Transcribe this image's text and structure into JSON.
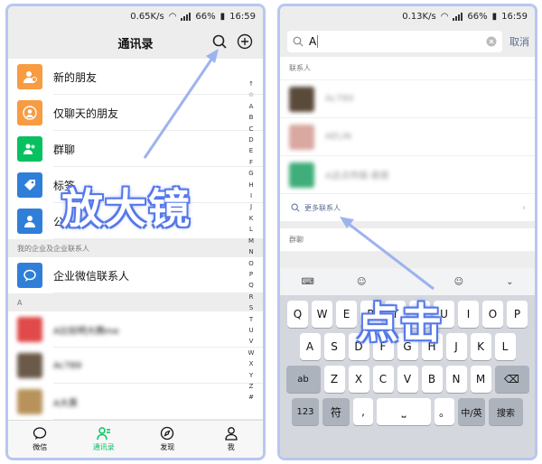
{
  "left": {
    "status": {
      "speed": "0.65K/s",
      "battery": "66%",
      "time": "16:59"
    },
    "title": "通讯录",
    "fixed_items": [
      {
        "label": "新的朋友",
        "color": "#f79c42",
        "icon": "person-add-icon"
      },
      {
        "label": "仅聊天的朋友",
        "color": "#f79c42",
        "icon": "person-icon"
      },
      {
        "label": "群聊",
        "color": "#07c160",
        "icon": "group-icon"
      },
      {
        "label": "标签",
        "color": "#2f7fd9",
        "icon": "tag-icon"
      },
      {
        "label": "公",
        "color": "#2f7fd9",
        "icon": "person-icon"
      }
    ],
    "enterprise_header": "我的企业及企业联系人",
    "enterprise_item": "企业微信联系人",
    "letter_header": "A",
    "contacts": [
      "A比较明大腾me",
      "Ac789",
      "A大黄"
    ],
    "alphabet": [
      "↑",
      "☆",
      "A",
      "B",
      "C",
      "D",
      "E",
      "F",
      "G",
      "H",
      "I",
      "J",
      "K",
      "L",
      "M",
      "N",
      "O",
      "P",
      "Q",
      "R",
      "S",
      "T",
      "U",
      "V",
      "W",
      "X",
      "Y",
      "Z",
      "#"
    ],
    "tabs": [
      {
        "label": "微信",
        "icon": "chat-icon",
        "active": false
      },
      {
        "label": "通讯录",
        "icon": "contacts-icon",
        "active": true
      },
      {
        "label": "发现",
        "icon": "compass-icon",
        "active": false
      },
      {
        "label": "我",
        "icon": "me-icon",
        "active": false
      }
    ],
    "annotation": "放大镜"
  },
  "right": {
    "status": {
      "speed": "0.13K/s",
      "battery": "66%",
      "time": "16:59"
    },
    "search_value": "A",
    "cancel_label": "取消",
    "contacts_header": "联系人",
    "results": [
      "Ac789",
      "AELIN",
      "A这点传媒-裘裘"
    ],
    "more_contacts": "更多联系人",
    "group_header": "群聊",
    "annotation": "点击",
    "keyboard": {
      "row1": [
        "Q",
        "W",
        "E",
        "R",
        "T",
        "Y",
        "U",
        "I",
        "O",
        "P"
      ],
      "row2": [
        "A",
        "S",
        "D",
        "F",
        "G",
        "H",
        "J",
        "K",
        "L"
      ],
      "row3": [
        "ab",
        "Z",
        "X",
        "C",
        "V",
        "B",
        "N",
        "M",
        "⌫"
      ],
      "row4": [
        "123",
        "符",
        ",",
        "⎵",
        "。",
        "中/英",
        "搜索"
      ]
    }
  }
}
